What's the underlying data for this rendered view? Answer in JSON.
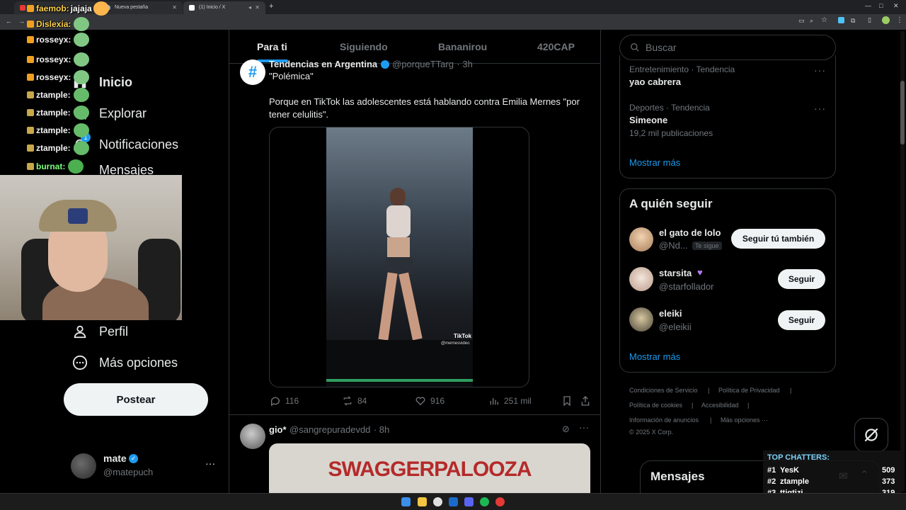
{
  "browser": {
    "tabs": [
      {
        "label": "Nueva pestaña"
      },
      {
        "label": "(1) Inicio / X"
      }
    ]
  },
  "chat": [
    {
      "user": "faemob:",
      "msg": "jajaja",
      "color": "#ffd24a"
    },
    {
      "user": "Dislexia:",
      "msg": "",
      "color": "#ffd24a"
    },
    {
      "user": "rosseyx:",
      "msg": "",
      "color": "#f3f3f3"
    },
    {
      "user": "rosseyx:",
      "msg": "",
      "color": "#f3f3f3"
    },
    {
      "user": "rosseyx:",
      "msg": "",
      "color": "#f3f3f3"
    },
    {
      "user": "ztample:",
      "msg": "",
      "color": "#f3f3f3"
    },
    {
      "user": "ztample:",
      "msg": "",
      "color": "#f3f3f3"
    },
    {
      "user": "ztample:",
      "msg": "",
      "color": "#f3f3f3"
    },
    {
      "user": "ztample:",
      "msg": "",
      "color": "#f3f3f3"
    },
    {
      "user": "burnat:",
      "msg": "",
      "color": "#7cff7c"
    }
  ],
  "nav": {
    "inicio": "Inicio",
    "explorar": "Explorar",
    "notificaciones": "Notificaciones",
    "notif_count": "1",
    "mensajes": "Mensajes",
    "perfil": "Perfil",
    "mas": "Más opciones",
    "post": "Postear"
  },
  "account": {
    "name": "mate",
    "handle": "@matepuch",
    "more": "···"
  },
  "feed_tabs": [
    "Para ti",
    "Siguiendo",
    "Bananirou",
    "420CAP"
  ],
  "post1": {
    "name": "Tendencias en Argentina",
    "handle": "@porqueTTarg",
    "time": "· 3h",
    "quote": "\"Polémica\"",
    "text": "Porque en TikTok las adolescentes está  hablando contra Emilia Mernes \"por tener celulitis\".",
    "watermark": "TikTok",
    "watermark_handle": "@mernesvideo",
    "replies": "116",
    "reposts": "84",
    "likes": "916",
    "views": "251 mil"
  },
  "post2": {
    "name": "gio*",
    "handle": "@sangrepuradevdd",
    "time": "· 8h",
    "image_text": "SWAGGERPALOOZA"
  },
  "search": {
    "placeholder": "Buscar"
  },
  "trends": [
    {
      "meta": "Entretenimiento · Tendencia",
      "name": "yao cabrera",
      "count": ""
    },
    {
      "meta": "Deportes · Tendencia",
      "name": "Simeone",
      "count": "19,2 mil publicaciones"
    }
  ],
  "show_more": "Mostrar más",
  "who_to_follow": {
    "title": "A quién seguir",
    "users": [
      {
        "name": "el gato de lolo",
        "handle": "@Nd...",
        "tag": "Te sigue",
        "button": "Seguir tú también"
      },
      {
        "name": "starsita",
        "handle": "@starfollador",
        "tag": "",
        "button": "Seguir"
      },
      {
        "name": "eleiki",
        "handle": "@eleikii",
        "tag": "",
        "button": "Seguir"
      }
    ],
    "show_more": "Mostrar más"
  },
  "footer": {
    "links": [
      "Condiciones de Servicio",
      "Política de Privacidad",
      "Política de cookies",
      "Accesibilidad",
      "Información de anuncios",
      "Más opciones ···"
    ],
    "copyright": "© 2025 X Corp."
  },
  "messages": {
    "title": "Mensajes"
  },
  "top_chatters": {
    "title": "TOP CHATTERS:",
    "rows": [
      {
        "rank": "#1",
        "name": "YesK",
        "count": "509"
      },
      {
        "rank": "#2",
        "name": "ztample",
        "count": "373"
      },
      {
        "rank": "#3",
        "name": "ttiqtizi",
        "count": "319"
      }
    ]
  },
  "colors": {
    "accent": "#1d9bf0",
    "bg": "#000000",
    "border": "#2f3336",
    "muted": "#71767b"
  }
}
